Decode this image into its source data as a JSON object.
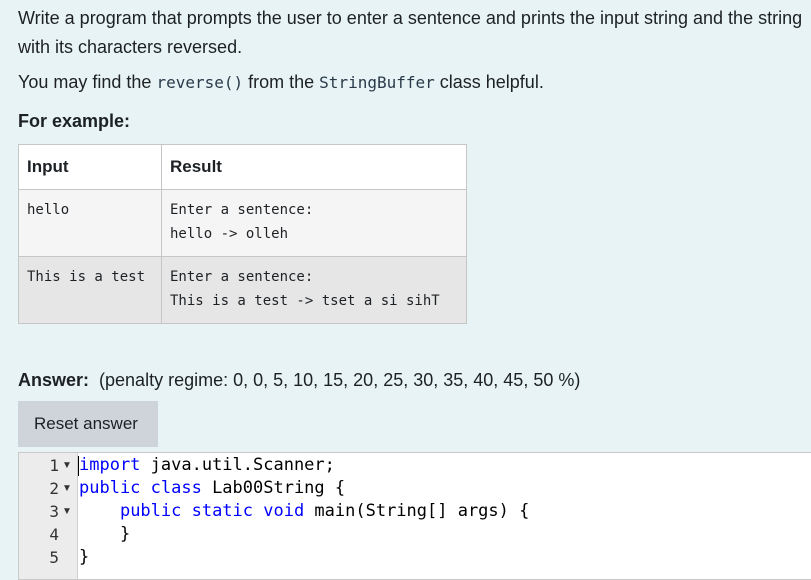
{
  "question": {
    "text": "Write a program that prompts the user to enter a sentence and prints the input string and the string with its characters reversed.",
    "hint_pre": "You may find the ",
    "hint_method": "reverse()",
    "hint_mid": " from the ",
    "hint_class": "StringBuffer",
    "hint_post": " class helpful.",
    "for_example": "For example:"
  },
  "examples": {
    "headers": [
      "Input",
      "Result"
    ],
    "rows": [
      {
        "input": "hello",
        "result": "Enter a sentence:\nhello -> olleh"
      },
      {
        "input": "This is a test",
        "result": "Enter a sentence:\nThis is a test -> tset a si sihT"
      }
    ]
  },
  "answer": {
    "label": "Answer:",
    "penalty": "(penalty regime: 0, 0, 5, 10, 15, 20, 25, 30, 35, 40, 45, 50 %)",
    "reset_label": "Reset answer"
  },
  "editor": {
    "line_numbers": [
      "1",
      "2",
      "3",
      "4",
      "5"
    ],
    "lines": [
      {
        "kw": "import",
        "rest": " java.util.Scanner;"
      },
      {
        "kw": "public class",
        "rest": " Lab00String {"
      },
      {
        "indent": "    ",
        "kw": "public static void",
        "rest": " main(String[] args) {"
      },
      {
        "indent": "    ",
        "kw": "",
        "rest": "}"
      },
      {
        "kw": "",
        "rest": "}"
      }
    ]
  }
}
